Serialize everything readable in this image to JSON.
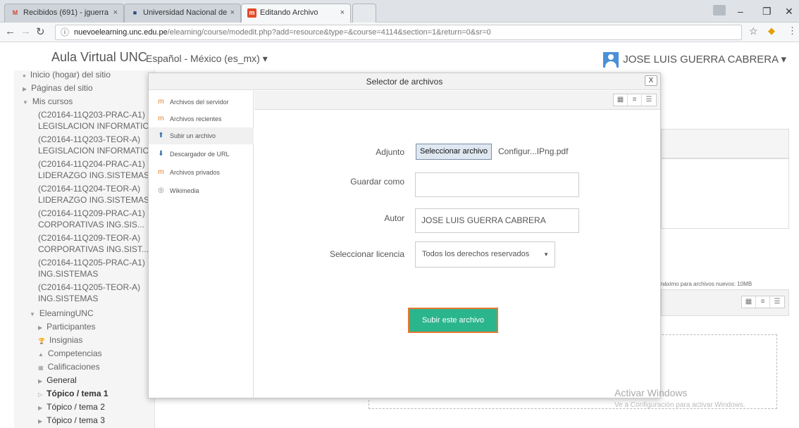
{
  "browser": {
    "tabs": [
      {
        "label": "Recibidos (691) - jguerra",
        "favicon": "M"
      },
      {
        "label": "Universidad Nacional de",
        "favicon": "■"
      },
      {
        "label": "Editando Archivo",
        "favicon": "m"
      }
    ],
    "url_host": "nuevoelearning.unc.edu.pe",
    "url_path": "/elearning/course/modedit.php?add=resource&type=&course=4114&section=1&return=0&sr=0"
  },
  "header": {
    "brand": "Aula Virtual UNC",
    "language": "Español - México (es_mx) ▾",
    "user": "JOSE LUIS GUERRA CABRERA ▾"
  },
  "sidebar": {
    "items": [
      "Inicio (hogar) del sitio",
      "Páginas del sitio",
      "Mis cursos",
      "(C20164-11Q203-PRAC-A1)",
      "LEGISLACION INFORMATIC",
      "(C20164-11Q203-TEOR-A)",
      "LEGISLACION INFORMATIC",
      "(C20164-11Q204-PRAC-A1)",
      "LIDERAZGO ING.SISTEMAS",
      "(C20164-11Q204-TEOR-A)",
      "LIDERAZGO ING.SISTEMAS",
      "(C20164-11Q209-PRAC-A1)",
      "CORPORATIVAS ING.SIS...",
      "(C20164-11Q209-TEOR-A)",
      "CORPORATIVAS ING.SIST...",
      "(C20164-11Q205-PRAC-A1)",
      "ING.SISTEMAS",
      "(C20164-11Q205-TEOR-A)",
      "ING.SISTEMAS",
      "ElearningUNC",
      "Participantes",
      "Insignias",
      "Competencias",
      "Calificaciones",
      "General",
      "Tópico / tema 1",
      "Tópico / tema 2",
      "Tópico / tema 3"
    ]
  },
  "modal": {
    "title": "Selector de archivos",
    "close": "X",
    "repositories": [
      "Archivos del servidor",
      "Archivos recientes",
      "Subir un archivo",
      "Descargador de URL",
      "Archivos privados",
      "Wikimedia"
    ],
    "adjunto_label": "Adjunto",
    "choose_button": "Seleccionar archivo",
    "chosen_file": "Configur...IPng.pdf",
    "guardar_label": "Guardar como",
    "guardar_value": "",
    "autor_label": "Autor",
    "autor_value": "JOSE LUIS GUERRA CABRERA",
    "licencia_label": "Seleccionar licencia",
    "licencia_value": "Todos los derechos reservados",
    "upload_button": "Subir este archivo"
  },
  "background": {
    "max_size_note": "año máximo para archivos nuevos: 10MB"
  },
  "watermark": {
    "line1": "Activar Windows",
    "line2": "Ve a Configuración para activar Windows."
  }
}
